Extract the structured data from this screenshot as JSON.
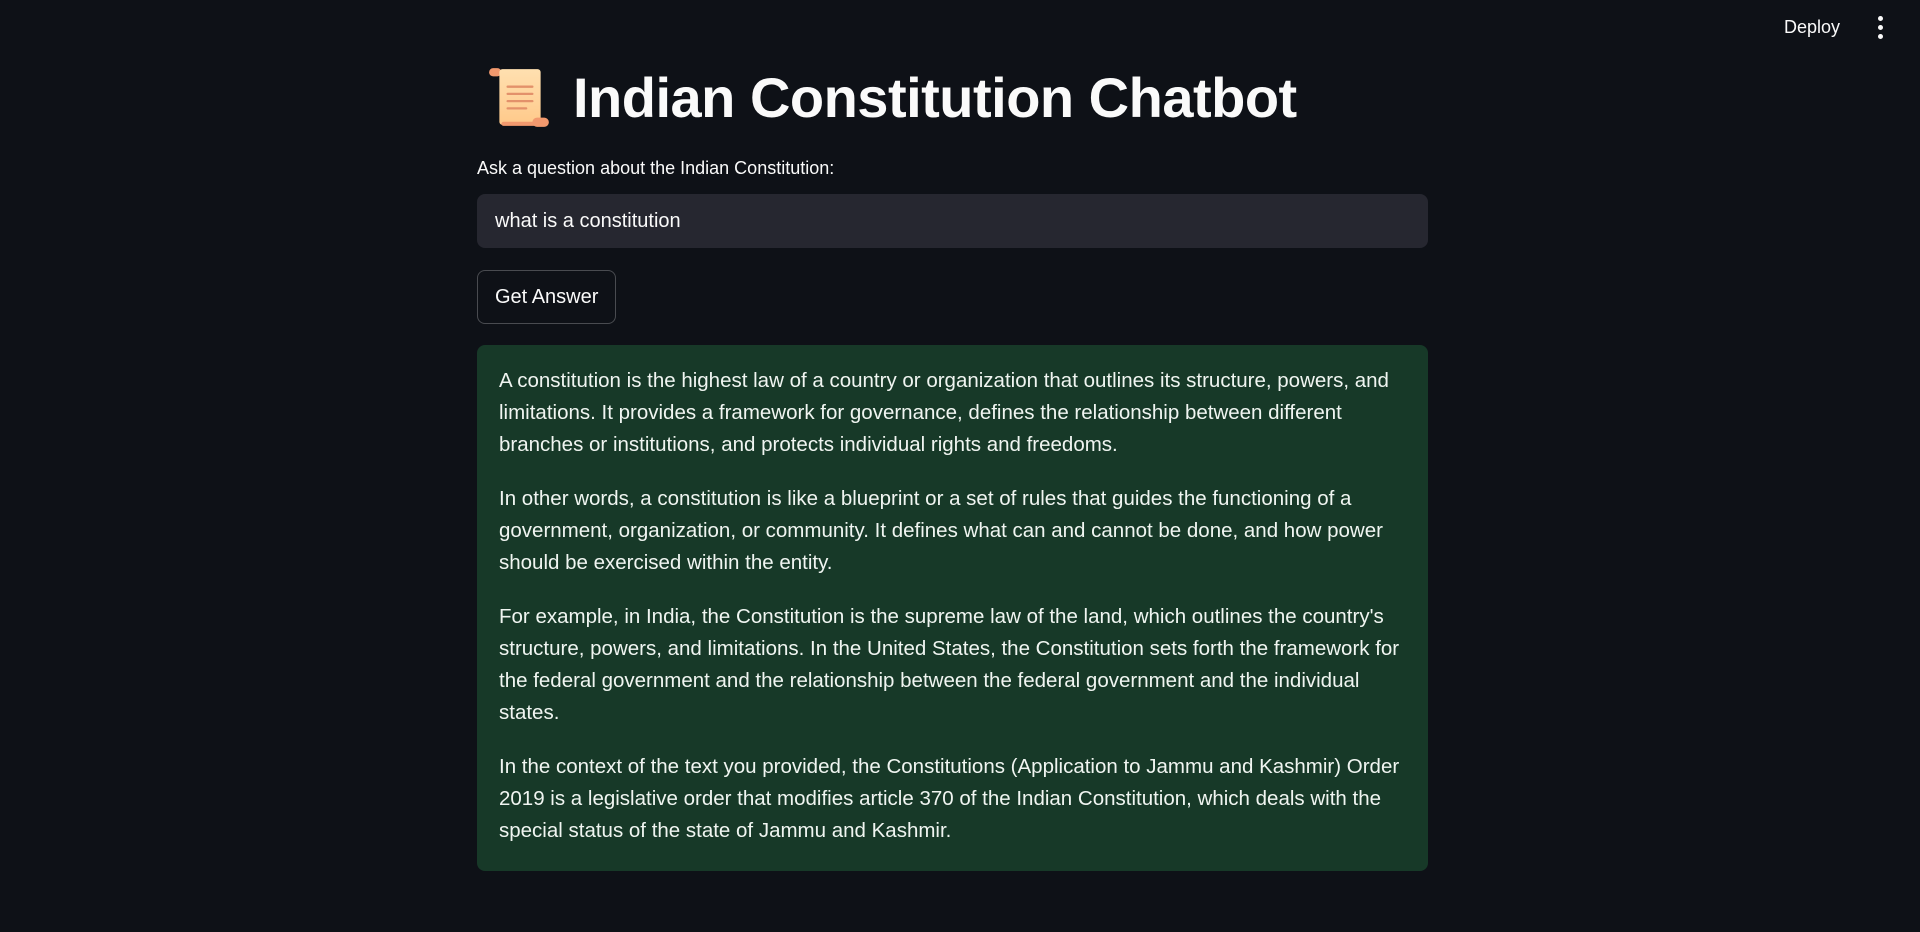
{
  "header": {
    "deploy_label": "Deploy",
    "menu_icon": "kebab-menu-icon"
  },
  "main": {
    "title_icon": "scroll-icon",
    "title": "Indian Constitution Chatbot",
    "input_label": "Ask a question about the Indian Constitution:",
    "input_value": "what is a constitution",
    "button_label": "Get Answer",
    "answer": {
      "paragraphs": [
        "A constitution is the highest law of a country or organization that outlines its structure, powers, and limitations. It provides a framework for governance, defines the relationship between different branches or institutions, and protects individual rights and freedoms.",
        "In other words, a constitution is like a blueprint or a set of rules that guides the functioning of a government, organization, or community. It defines what can and cannot be done, and how power should be exercised within the entity.",
        "For example, in India, the Constitution is the supreme law of the land, which outlines the country's structure, powers, and limitations. In the United States, the Constitution sets forth the framework for the federal government and the relationship between the federal government and the individual states.",
        "In the context of the text you provided, the Constitutions (Application to Jammu and Kashmir) Order 2019 is a legislative order that modifies article 370 of the Indian Constitution, which deals with the special status of the state of Jammu and Kashmir."
      ]
    }
  },
  "colors": {
    "background": "#0e1117",
    "input_bg": "#262730",
    "answer_bg": "#173928",
    "text": "#fafafa"
  }
}
